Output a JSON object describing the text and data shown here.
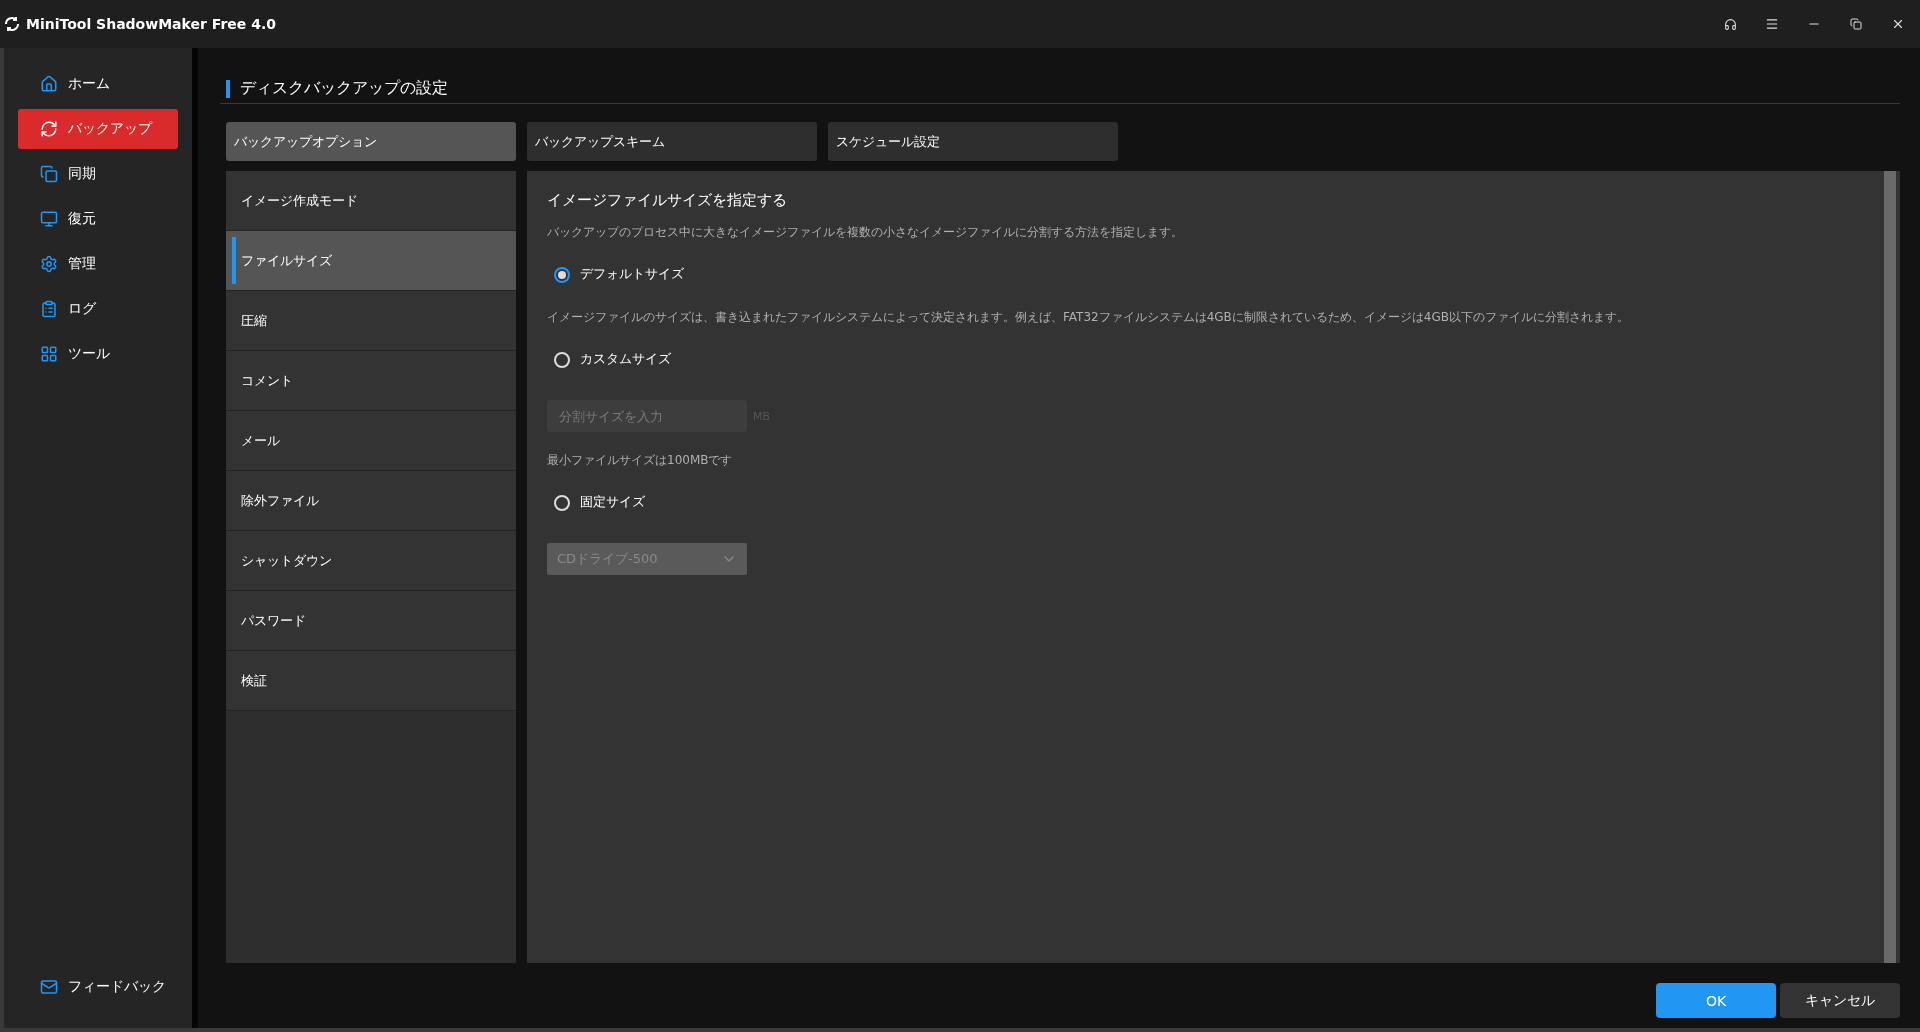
{
  "window": {
    "title": "MiniTool ShadowMaker Free 4.0"
  },
  "sidebar": {
    "items": [
      {
        "label": "ホーム",
        "selected": false
      },
      {
        "label": "バックアップ",
        "selected": true
      },
      {
        "label": "同期",
        "selected": false
      },
      {
        "label": "復元",
        "selected": false
      },
      {
        "label": "管理",
        "selected": false
      },
      {
        "label": "ログ",
        "selected": false
      },
      {
        "label": "ツール",
        "selected": false
      }
    ],
    "feedback": "フィードバック"
  },
  "page": {
    "title": "ディスクバックアップの設定",
    "tabs": [
      {
        "label": "バックアップオプション",
        "selected": true
      },
      {
        "label": "バックアップスキーム",
        "selected": false
      },
      {
        "label": "スケジュール設定",
        "selected": false
      }
    ],
    "options_list": [
      {
        "label": "イメージ作成モード",
        "selected": false
      },
      {
        "label": "ファイルサイズ",
        "selected": true
      },
      {
        "label": "圧縮",
        "selected": false
      },
      {
        "label": "コメント",
        "selected": false
      },
      {
        "label": "メール",
        "selected": false
      },
      {
        "label": "除外ファイル",
        "selected": false
      },
      {
        "label": "シャットダウン",
        "selected": false
      },
      {
        "label": "パスワード",
        "selected": false
      },
      {
        "label": "検証",
        "selected": false
      }
    ],
    "panel": {
      "heading": "イメージファイルサイズを指定する",
      "description": "バックアップのプロセス中に大きなイメージファイルを複数の小さなイメージファイルに分割する方法を指定します。",
      "choices": [
        {
          "kind": "note",
          "label": "デフォルトサイズ",
          "selected": true,
          "note": "イメージファイルのサイズは、書き込まれたファイルシステムによって決定されます。例えば、FAT32ファイルシステムは4GBに制限されているため、イメージは4GB以下のファイルに分割されます。"
        },
        {
          "kind": "input",
          "label": "カスタムサイズ",
          "selected": false,
          "placeholder": "分割サイズを入力",
          "unit": "MB",
          "disabled": true,
          "note": "最小ファイルサイズは100MBです"
        },
        {
          "kind": "select",
          "label": "固定サイズ",
          "selected": false,
          "value": "CDドライブ-500",
          "disabled": true
        }
      ]
    }
  },
  "buttons": {
    "ok": "OK",
    "cancel": "キャンセル"
  }
}
